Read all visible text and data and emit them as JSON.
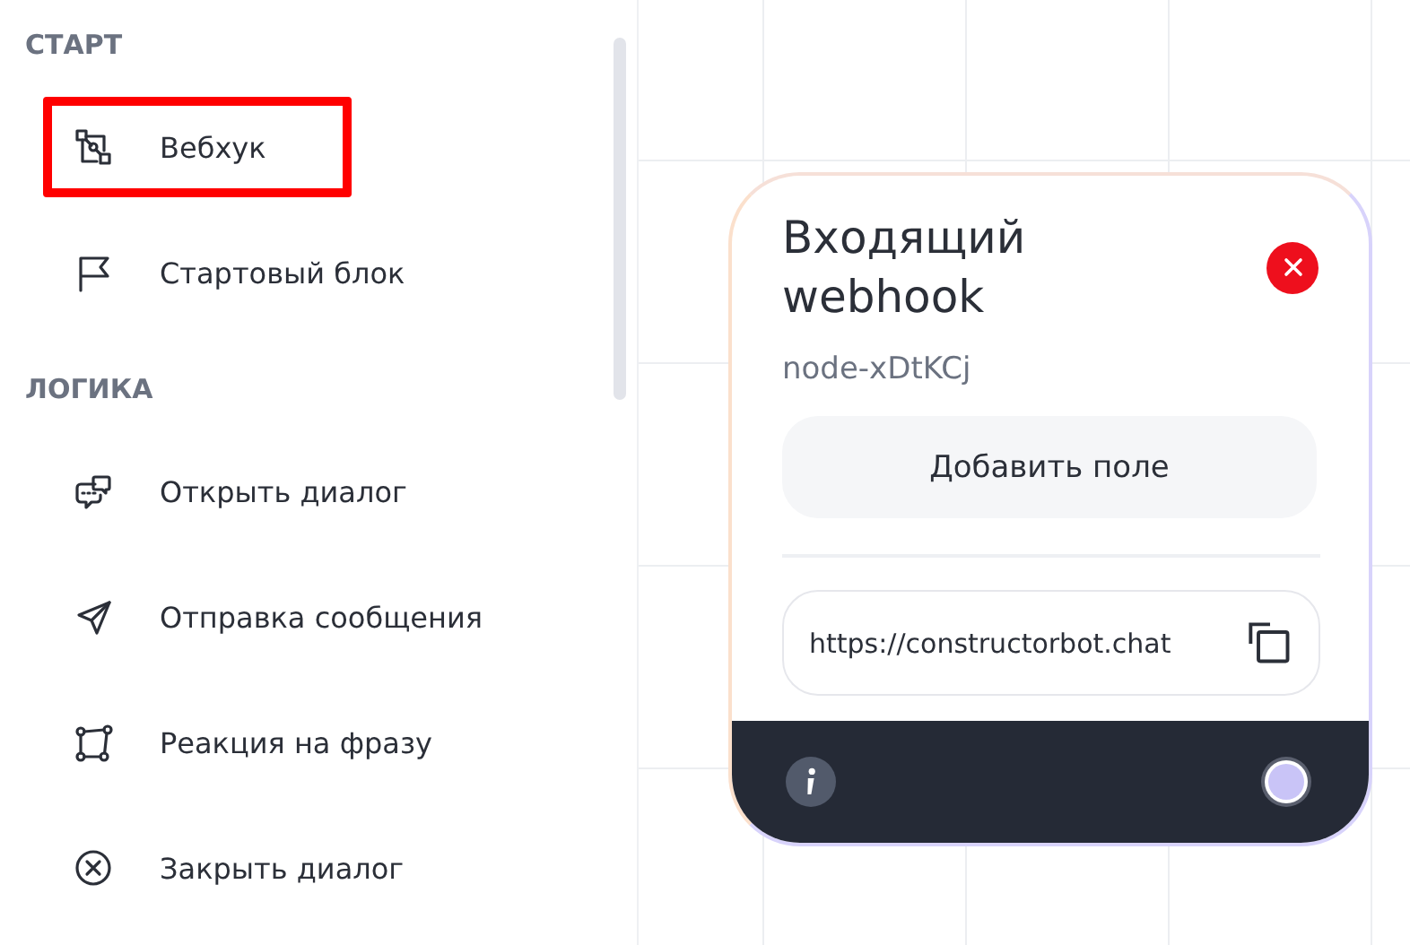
{
  "sidebar": {
    "sections": [
      {
        "title": "СТАРТ",
        "items": [
          {
            "label": "Вебхук",
            "kind": "webhook",
            "highlighted": true
          },
          {
            "label": "Стартовый блок",
            "kind": "flag",
            "highlighted": false
          }
        ]
      },
      {
        "title": "ЛОГИКА",
        "items": [
          {
            "label": "Открыть диалог",
            "kind": "chat",
            "highlighted": false
          },
          {
            "label": "Отправка сообщения",
            "kind": "send",
            "highlighted": false
          },
          {
            "label": "Реакция на фразу",
            "kind": "shape",
            "highlighted": false
          },
          {
            "label": "Закрыть диалог",
            "kind": "close",
            "highlighted": false
          }
        ]
      }
    ]
  },
  "node": {
    "title": "Входящий webhook",
    "id": "node-xDtKCj",
    "add_button": "Добавить поле",
    "url": "https://constructorbot.chat"
  }
}
